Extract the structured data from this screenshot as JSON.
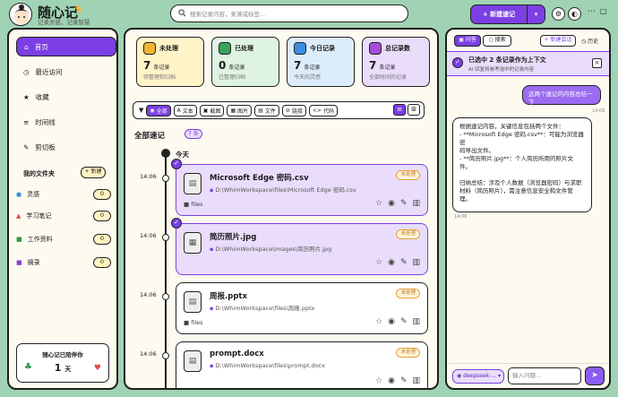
{
  "app": {
    "title": "随心记",
    "subtitle": "记录灵感，记录智慧",
    "star_icon": "star-icon"
  },
  "search": {
    "placeholder": "搜索记录内容，来源或标签..."
  },
  "top": {
    "new_label": "新建速记"
  },
  "sidebar": {
    "nav": [
      {
        "label": "首页",
        "icon": "home-icon",
        "active": true
      },
      {
        "label": "最近访问",
        "icon": "clock-icon"
      },
      {
        "label": "收藏",
        "icon": "star-icon"
      },
      {
        "label": "时间线",
        "icon": "timeline-icon"
      },
      {
        "label": "剪切板",
        "icon": "pin-icon"
      }
    ],
    "folders_title": "我的文件夹",
    "new_folder": "新建",
    "folders": [
      {
        "label": "灵感",
        "count": "0",
        "color": "#f2b632"
      },
      {
        "label": "学习笔记",
        "count": "0",
        "color": "#e24a4a"
      },
      {
        "label": "工作资料",
        "count": "0",
        "color": "#2f9a48"
      },
      {
        "label": "摘录",
        "count": "0",
        "color": "#8a3fd1"
      }
    ],
    "streak": {
      "title": "随心记已陪伴你",
      "days": "1",
      "unit": "天"
    }
  },
  "stats": [
    {
      "title": "未处理",
      "num": "7",
      "unit": "条记录",
      "sub": "待整理和归档",
      "bg": "#fff3c8",
      "icon_bg": "#f2b632"
    },
    {
      "title": "已处理",
      "num": "0",
      "unit": "条记录",
      "sub": "已整理归档",
      "bg": "#dff3e2",
      "icon_bg": "#3aa35a"
    },
    {
      "title": "今日记录",
      "num": "7",
      "unit": "条记录",
      "sub": "今天的灵感",
      "bg": "#dcecfb",
      "icon_bg": "#3b8fe0"
    },
    {
      "title": "总记录数",
      "num": "7",
      "unit": "条记录",
      "sub": "全部时间的记录",
      "bg": "#eadcfb",
      "icon_bg": "#a64bd8"
    }
  ],
  "filters": [
    "全部",
    "文本",
    "截图",
    "图片",
    "文件",
    "链接",
    "代码"
  ],
  "list": {
    "title": "全部速记",
    "count": "7 条",
    "today": "今天"
  },
  "records": [
    {
      "time": "14:06",
      "name": "Microsoft Edge 密码.csv",
      "path": "D:\\WhimWorkspace\\files\\Microsoft Edge 密码.csv",
      "tag": "files",
      "status": "未处理",
      "selected": true
    },
    {
      "time": "14:06",
      "name": "简历照片.jpg",
      "path": "D:\\WhimWorkspace\\images\\简历照片.jpg",
      "tag": "",
      "status": "未处理",
      "selected": true
    },
    {
      "time": "14:06",
      "name": "周报.pptx",
      "path": "D:\\WhimWorkspace\\files\\周报.pptx",
      "tag": "files",
      "status": "未处理",
      "selected": false
    },
    {
      "time": "14:06",
      "name": "prompt.docx",
      "path": "D:\\WhimWorkspace\\files\\prompt.docx",
      "tag": "",
      "status": "未处理",
      "selected": false
    }
  ],
  "chat": {
    "tab_ask": "问答",
    "tab_search": "搜索",
    "new_chat": "新建会话",
    "history": "历史",
    "ctx_title": "已选中 2 条记录作为上下文",
    "ctx_sub": "AI 回复将参考选中的记录内容",
    "user_msg": "这两个速记的内容总结一下",
    "user_time": "14:06",
    "ai_lines": [
      "根据速记内容，关键信息包括两个文件：",
      "- **Microsoft Edge 密码.csv**：可能为浏览器密",
      "码导出文件。",
      "- **简历照片.jpg**：个人简历所用的照片文件。",
      "",
      "归纳总结：涉及个人数据（浏览器密码）与求职",
      "材料（简历照片），需注意信息安全和文件管",
      "理。"
    ],
    "ai_time": "14:06",
    "model": "deepseek-...",
    "input_placeholder": "输入问题..."
  }
}
